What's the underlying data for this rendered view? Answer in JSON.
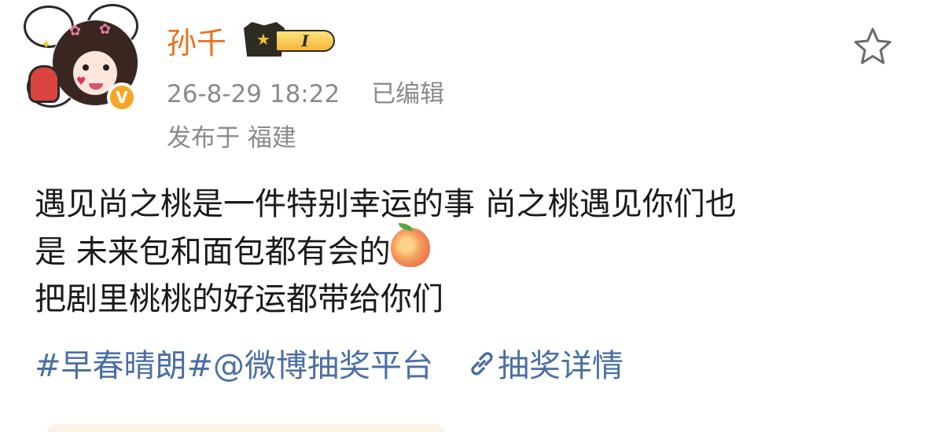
{
  "post": {
    "username": "孙千",
    "vip_level": "I",
    "timestamp": "26-8-29 18:22",
    "edited_label": "已编辑",
    "location": "发布于 福建",
    "verified_mark": "V",
    "favorite_icon": "star-outline-icon",
    "content_lines": [
      "遇见尚之桃是一件特别幸运的事 尚之桃遇见你们也",
      "是 未来包和面包都有会的",
      "把剧里桃桃的好运都带给你们"
    ],
    "emoji": "peach-icon",
    "hashtag": "#早春晴朗#",
    "mention": "@微博抽奖平台",
    "lottery_link": "抽奖详情",
    "colors": {
      "username": "#e8701a",
      "meta": "#8a8a8a",
      "link": "#4a6fa5",
      "verified": "#f5a623"
    }
  }
}
